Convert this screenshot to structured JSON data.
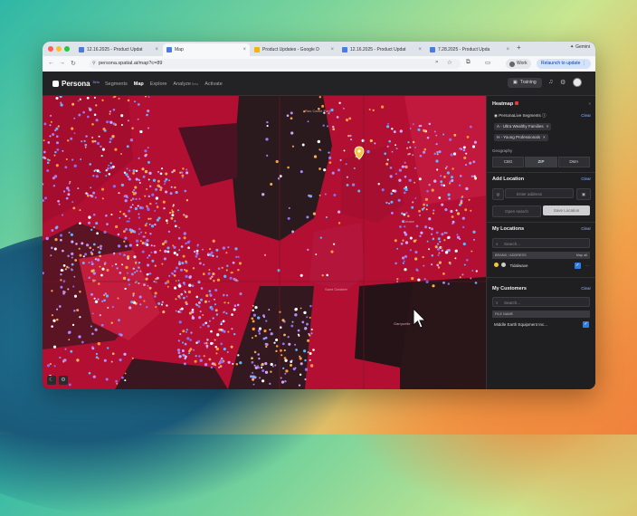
{
  "browser": {
    "tabs": [
      {
        "title": "12.16.2025 - Product Updat",
        "fav": "#4a7be0"
      },
      {
        "title": "Map",
        "fav": "#4a7be0"
      },
      {
        "title": "Product Updates - Google D",
        "fav": "#f5b400"
      },
      {
        "title": "12.16.2025 - Product Updat",
        "fav": "#4a7be0"
      },
      {
        "title": "7.28.2025 - Product Upda",
        "fav": "#4a7be0"
      }
    ],
    "gemini": "Gemini",
    "url": "persona.spatial.ai/map?c=89",
    "profile": "Work",
    "relaunch": "Relaunch to update"
  },
  "app": {
    "brand": "Persona",
    "brand_sup": "Beta",
    "nav": [
      "Segments",
      "Map",
      "Explore",
      "Analyze",
      "Activate"
    ],
    "analyze_badge": "Beta",
    "training": "Training"
  },
  "panel": {
    "heatmap": {
      "title": "Heatmap",
      "segments_label": "PersonaLive Segments",
      "clear": "Clear",
      "chips": [
        "A - Ultra Wealthy Families",
        "H - Young Professionals"
      ]
    },
    "geography": {
      "label": "Geography",
      "options": [
        "CBG",
        "ZIP",
        "DMA"
      ],
      "selected": "ZIP"
    },
    "add_location": {
      "title": "Add Location",
      "clear": "Clear",
      "placeholder": "Enter address",
      "open_search": "Open search",
      "save": "Save Location"
    },
    "my_locations": {
      "title": "My Locations",
      "clear": "Clear",
      "search": "Search...",
      "col": "BRAND / ADDRESS",
      "map_all": "Map all",
      "rows": [
        "Tidalwave"
      ]
    },
    "my_customers": {
      "title": "My Customers",
      "clear": "Clear",
      "search": "Search...",
      "col": "FILE NAME",
      "rows": [
        "Middle Earth Equipment Inc..."
      ]
    }
  },
  "map": {
    "labels": [
      "Reo Carrie Park",
      "Saint Gardner",
      "Crease",
      "Garryuelle"
    ]
  }
}
